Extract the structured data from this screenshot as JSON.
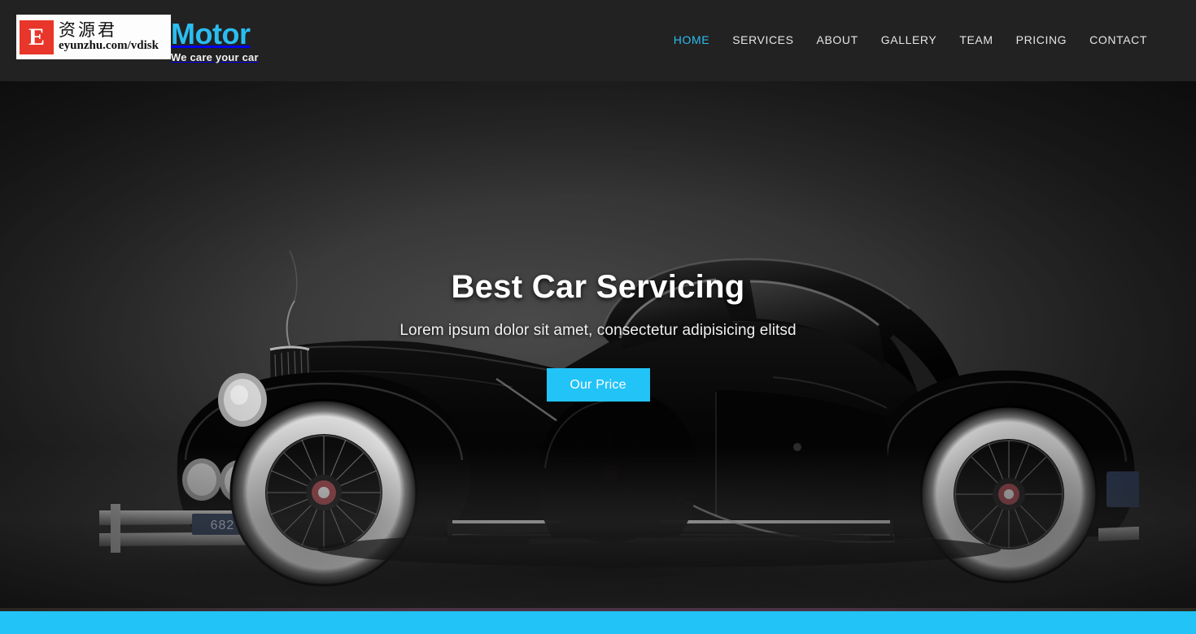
{
  "header": {
    "brand_name": "Motor",
    "brand_tagline": "We care your car",
    "nav": [
      {
        "label": "HOME",
        "active": true
      },
      {
        "label": "SERVICES",
        "active": false
      },
      {
        "label": "ABOUT",
        "active": false
      },
      {
        "label": "GALLERY",
        "active": false
      },
      {
        "label": "TEAM",
        "active": false
      },
      {
        "label": "PRICING",
        "active": false
      },
      {
        "label": "CONTACT",
        "active": false
      }
    ],
    "background_color": "#222222",
    "accent_color": "#2bbdf0"
  },
  "watermark": {
    "logo_letter": "E",
    "chinese_text": "资源君",
    "url_text": "eyunzhu.com/vdisk",
    "logo_color": "#e8362a",
    "background_color": "#fdfdfd"
  },
  "hero": {
    "title": "Best Car Servicing",
    "subtitle": "Lorem ipsum dolor sit amet, consectetur adipisicing elitsd",
    "button_label": "Our Price",
    "button_color": "#22c3f7",
    "image_alt": "vintage black classic car on dark studio background"
  },
  "bottom_bar": {
    "color": "#22c3f7"
  }
}
